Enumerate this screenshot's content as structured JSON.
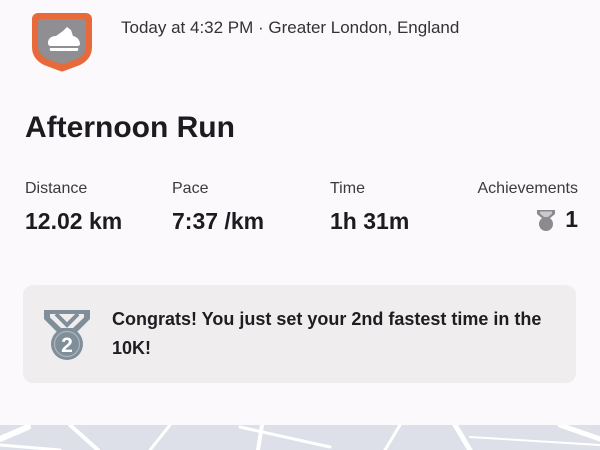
{
  "activity": {
    "datetime": "Today at 4:32 PM",
    "separator": " · ",
    "location": "Greater London, England",
    "title": "Afternoon Run"
  },
  "stats": {
    "distance": {
      "label": "Distance",
      "value": "12.02 km"
    },
    "pace": {
      "label": "Pace",
      "value": "7:37 /km"
    },
    "time": {
      "label": "Time",
      "value": "1h 31m"
    },
    "achievements": {
      "label": "Achievements",
      "count": "1",
      "icon": "medal-icon"
    }
  },
  "achievement_banner": {
    "icon": "silver-medal-icon",
    "medal_number": "2",
    "text": "Congrats! You just set your 2nd fastest time in the 10K!"
  },
  "icons": {
    "activity_type": "running-shoe-icon"
  },
  "colors": {
    "brand_orange": "#e8693a",
    "icon_gray": "#8a8a8f",
    "medal_silver": "#7f8e99",
    "banner_bg": "#efedee",
    "map_bg": "#dde0e8"
  }
}
